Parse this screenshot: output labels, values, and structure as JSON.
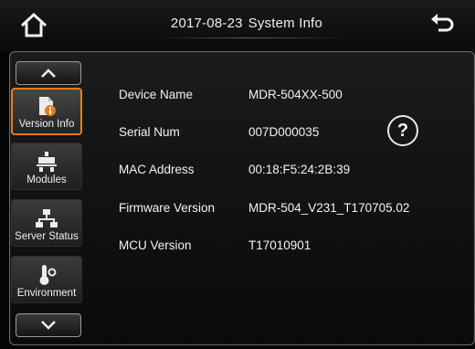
{
  "header": {
    "date": "2017-08-23",
    "title": "System Info",
    "home_icon": "home-icon",
    "back_icon": "back-arrow-icon"
  },
  "sidebar": {
    "scroll_up_icon": "chevron-up-icon",
    "scroll_down_icon": "chevron-down-icon",
    "items": [
      {
        "label": "Version Info",
        "icon": "document-info-icon",
        "active": true
      },
      {
        "label": "Modules",
        "icon": "modules-icon",
        "active": false
      },
      {
        "label": "Server Status",
        "icon": "network-icon",
        "active": false
      },
      {
        "label": "Environment",
        "icon": "thermometer-icon",
        "active": false
      }
    ]
  },
  "info": [
    {
      "label": "Device Name",
      "value": "MDR-504XX-500"
    },
    {
      "label": "Serial Num",
      "value": "007D000035"
    },
    {
      "label": "MAC Address",
      "value": "00:18:F5:24:2B:39"
    },
    {
      "label": "Firmware Version",
      "value": "MDR-504_V231_T170705.02"
    },
    {
      "label": "MCU Version",
      "value": "T17010901"
    }
  ],
  "help": {
    "glyph": "?"
  },
  "colors": {
    "accent": "#e27f1b",
    "background": "#050505",
    "text": "#e9e9e9"
  }
}
